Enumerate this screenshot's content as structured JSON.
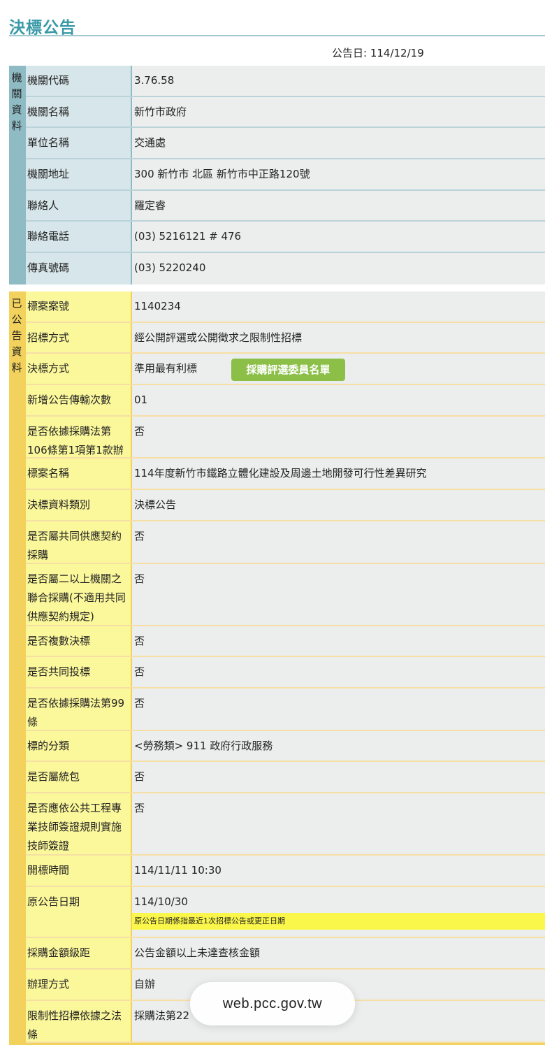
{
  "page": {
    "title": "決標公告",
    "pub_date": "公告日: 114/12/19"
  },
  "agency": {
    "section_label": [
      "機",
      "關",
      "資",
      "料"
    ],
    "rows": [
      {
        "label": "機關代碼",
        "value": "3.76.58"
      },
      {
        "label": "機關名稱",
        "value": "新竹市政府"
      },
      {
        "label": "單位名稱",
        "value": "交通處"
      },
      {
        "label": "機關地址",
        "value": "300 新竹市 北區 新竹市中正路120號"
      },
      {
        "label": "聯絡人",
        "value": "羅定睿"
      },
      {
        "label": "聯絡電話",
        "value": "(03) 5216121 # 476"
      },
      {
        "label": "傳真號碼",
        "value": "(03) 5220240"
      }
    ]
  },
  "announced": {
    "section_label": [
      "已",
      "公",
      "告",
      "資",
      "料"
    ],
    "eval_button": "採購評選委員名單",
    "rows": [
      {
        "label": "標案案號",
        "value": "1140234"
      },
      {
        "label": "招標方式",
        "value": "經公開評選或公開徵求之限制性招標"
      },
      {
        "label": "決標方式",
        "value": "準用最有利標"
      },
      {
        "label": "新增公告傳輸次數",
        "value": "01"
      },
      {
        "label": "是否依據採購法第106條第1項第1款辦理",
        "value": "否"
      },
      {
        "label": "標案名稱",
        "value": "114年度新竹市鐵路立體化建設及周邊土地開發可行性差異研究"
      },
      {
        "label": "決標資料類別",
        "value": "決標公告"
      },
      {
        "label": "是否屬共同供應契約採購",
        "value": "否"
      },
      {
        "label": "是否屬二以上機關之聯合採購(不適用共同供應契約規定)",
        "value": "否"
      },
      {
        "label": "是否複數決標",
        "value": "否"
      },
      {
        "label": "是否共同投標",
        "value": "否"
      },
      {
        "label": "是否依據採購法第99條",
        "value": "否"
      },
      {
        "label": "標的分類",
        "value": "<勞務類> 911 政府行政服務"
      },
      {
        "label": "是否屬統包",
        "value": "否"
      },
      {
        "label": "是否應依公共工程專業技師簽證規則實施技師簽證",
        "value": "否"
      },
      {
        "label": "開標時間",
        "value": "114/11/11 10:30"
      },
      {
        "label": "原公告日期",
        "value": "114/10/30",
        "note": "原公告日期係指最近1次招標公告或更正日期"
      },
      {
        "label": "採購金額級距",
        "value": "公告金額以上未達查核金額"
      },
      {
        "label": "辦理方式",
        "value": "自辦"
      },
      {
        "label": "限制性招標依據之法條",
        "value": "採購法第22"
      }
    ]
  },
  "browser": {
    "url": "web.pcc.gov.tw"
  }
}
